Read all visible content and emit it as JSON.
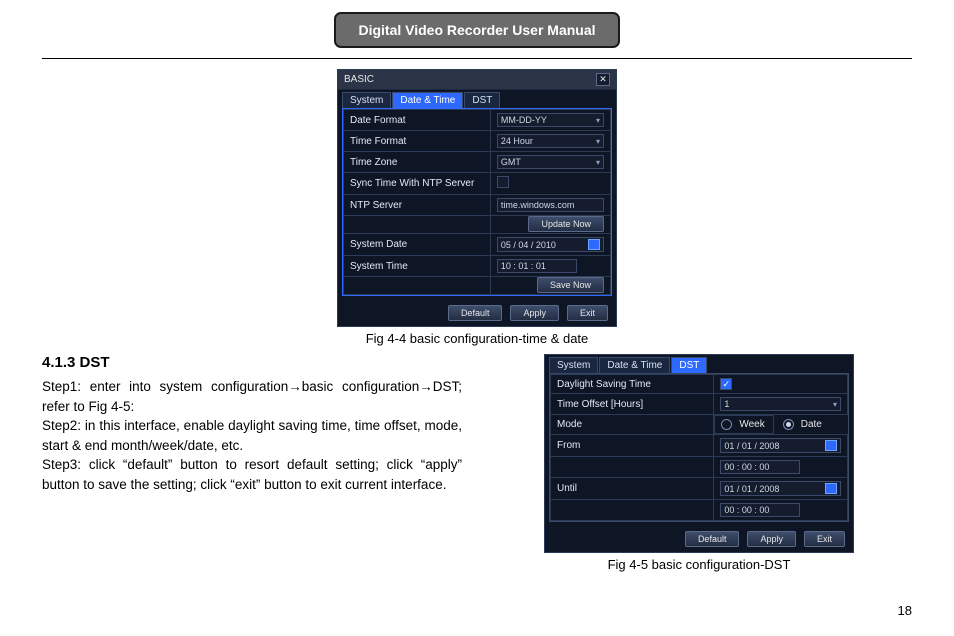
{
  "header": {
    "title": "Digital Video Recorder User Manual"
  },
  "fig1": {
    "window_title": "BASIC",
    "tabs": [
      "System",
      "Date & Time",
      "DST"
    ],
    "active_tab_index": 1,
    "rows": {
      "date_format": {
        "label": "Date Format",
        "value": "MM-DD-YY"
      },
      "time_format": {
        "label": "Time Format",
        "value": "24 Hour"
      },
      "time_zone": {
        "label": "Time Zone",
        "value": "GMT"
      },
      "sync_ntp": {
        "label": "Sync Time With NTP Server"
      },
      "ntp_server": {
        "label": "NTP Server",
        "value": "time.windows.com"
      },
      "update_btn": "Update Now",
      "system_date": {
        "label": "System Date",
        "value": "05 / 04 / 2010"
      },
      "system_time": {
        "label": "System Time",
        "value": "10 : 01 : 01"
      },
      "save_btn": "Save Now"
    },
    "buttons": {
      "default": "Default",
      "apply": "Apply",
      "exit": "Exit"
    },
    "caption": "Fig 4-4 basic configuration-time & date"
  },
  "section": {
    "heading": "4.1.3  DST",
    "step1": "Step1: enter into system configuration→basic configuration→DST; refer to Fig 4-5:",
    "step2": "Step2: in this interface, enable daylight saving time, time offset, mode, start & end month/week/date, etc.",
    "step3": "Step3: click “default” button to resort default setting; click “apply” button to save the setting; click “exit” button to exit current interface."
  },
  "fig2": {
    "tabs": [
      "System",
      "Date & Time",
      "DST"
    ],
    "active_tab_index": 2,
    "rows": {
      "dst_enable": {
        "label": "Daylight Saving Time"
      },
      "time_offset": {
        "label": "Time Offset [Hours]",
        "value": "1"
      },
      "mode": {
        "label": "Mode",
        "week": "Week",
        "date": "Date",
        "selected": "date"
      },
      "from": {
        "label": "From",
        "date": "01 / 01 / 2008",
        "time": "00 : 00 : 00"
      },
      "until": {
        "label": "Until",
        "date": "01 / 01 / 2008",
        "time": "00 : 00 : 00"
      }
    },
    "buttons": {
      "default": "Default",
      "apply": "Apply",
      "exit": "Exit"
    },
    "caption": "Fig 4-5 basic configuration-DST"
  },
  "page_number": "18"
}
